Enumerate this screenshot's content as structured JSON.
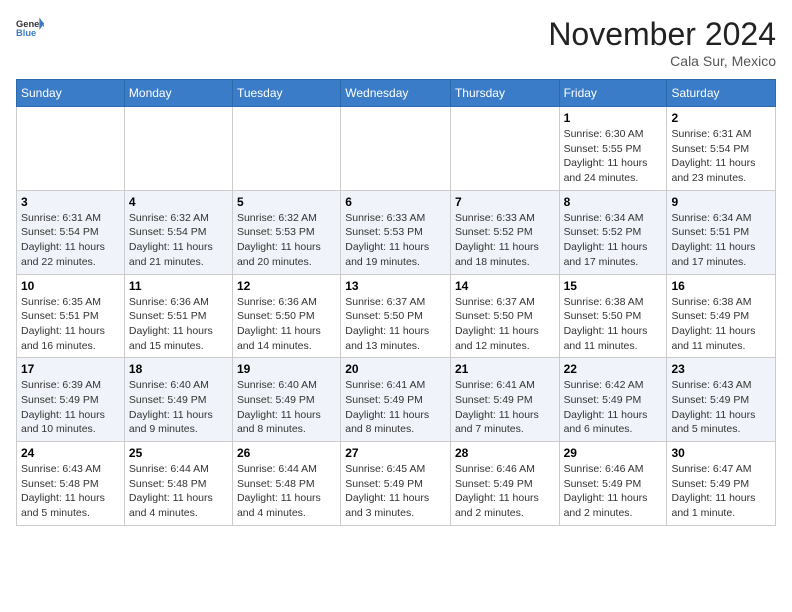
{
  "header": {
    "logo_general": "General",
    "logo_blue": "Blue",
    "month_title": "November 2024",
    "location": "Cala Sur, Mexico"
  },
  "weekdays": [
    "Sunday",
    "Monday",
    "Tuesday",
    "Wednesday",
    "Thursday",
    "Friday",
    "Saturday"
  ],
  "weeks": [
    [
      {
        "day": "",
        "info": ""
      },
      {
        "day": "",
        "info": ""
      },
      {
        "day": "",
        "info": ""
      },
      {
        "day": "",
        "info": ""
      },
      {
        "day": "",
        "info": ""
      },
      {
        "day": "1",
        "info": "Sunrise: 6:30 AM\nSunset: 5:55 PM\nDaylight: 11 hours and 24 minutes."
      },
      {
        "day": "2",
        "info": "Sunrise: 6:31 AM\nSunset: 5:54 PM\nDaylight: 11 hours and 23 minutes."
      }
    ],
    [
      {
        "day": "3",
        "info": "Sunrise: 6:31 AM\nSunset: 5:54 PM\nDaylight: 11 hours and 22 minutes."
      },
      {
        "day": "4",
        "info": "Sunrise: 6:32 AM\nSunset: 5:54 PM\nDaylight: 11 hours and 21 minutes."
      },
      {
        "day": "5",
        "info": "Sunrise: 6:32 AM\nSunset: 5:53 PM\nDaylight: 11 hours and 20 minutes."
      },
      {
        "day": "6",
        "info": "Sunrise: 6:33 AM\nSunset: 5:53 PM\nDaylight: 11 hours and 19 minutes."
      },
      {
        "day": "7",
        "info": "Sunrise: 6:33 AM\nSunset: 5:52 PM\nDaylight: 11 hours and 18 minutes."
      },
      {
        "day": "8",
        "info": "Sunrise: 6:34 AM\nSunset: 5:52 PM\nDaylight: 11 hours and 17 minutes."
      },
      {
        "day": "9",
        "info": "Sunrise: 6:34 AM\nSunset: 5:51 PM\nDaylight: 11 hours and 17 minutes."
      }
    ],
    [
      {
        "day": "10",
        "info": "Sunrise: 6:35 AM\nSunset: 5:51 PM\nDaylight: 11 hours and 16 minutes."
      },
      {
        "day": "11",
        "info": "Sunrise: 6:36 AM\nSunset: 5:51 PM\nDaylight: 11 hours and 15 minutes."
      },
      {
        "day": "12",
        "info": "Sunrise: 6:36 AM\nSunset: 5:50 PM\nDaylight: 11 hours and 14 minutes."
      },
      {
        "day": "13",
        "info": "Sunrise: 6:37 AM\nSunset: 5:50 PM\nDaylight: 11 hours and 13 minutes."
      },
      {
        "day": "14",
        "info": "Sunrise: 6:37 AM\nSunset: 5:50 PM\nDaylight: 11 hours and 12 minutes."
      },
      {
        "day": "15",
        "info": "Sunrise: 6:38 AM\nSunset: 5:50 PM\nDaylight: 11 hours and 11 minutes."
      },
      {
        "day": "16",
        "info": "Sunrise: 6:38 AM\nSunset: 5:49 PM\nDaylight: 11 hours and 11 minutes."
      }
    ],
    [
      {
        "day": "17",
        "info": "Sunrise: 6:39 AM\nSunset: 5:49 PM\nDaylight: 11 hours and 10 minutes."
      },
      {
        "day": "18",
        "info": "Sunrise: 6:40 AM\nSunset: 5:49 PM\nDaylight: 11 hours and 9 minutes."
      },
      {
        "day": "19",
        "info": "Sunrise: 6:40 AM\nSunset: 5:49 PM\nDaylight: 11 hours and 8 minutes."
      },
      {
        "day": "20",
        "info": "Sunrise: 6:41 AM\nSunset: 5:49 PM\nDaylight: 11 hours and 8 minutes."
      },
      {
        "day": "21",
        "info": "Sunrise: 6:41 AM\nSunset: 5:49 PM\nDaylight: 11 hours and 7 minutes."
      },
      {
        "day": "22",
        "info": "Sunrise: 6:42 AM\nSunset: 5:49 PM\nDaylight: 11 hours and 6 minutes."
      },
      {
        "day": "23",
        "info": "Sunrise: 6:43 AM\nSunset: 5:49 PM\nDaylight: 11 hours and 5 minutes."
      }
    ],
    [
      {
        "day": "24",
        "info": "Sunrise: 6:43 AM\nSunset: 5:48 PM\nDaylight: 11 hours and 5 minutes."
      },
      {
        "day": "25",
        "info": "Sunrise: 6:44 AM\nSunset: 5:48 PM\nDaylight: 11 hours and 4 minutes."
      },
      {
        "day": "26",
        "info": "Sunrise: 6:44 AM\nSunset: 5:48 PM\nDaylight: 11 hours and 4 minutes."
      },
      {
        "day": "27",
        "info": "Sunrise: 6:45 AM\nSunset: 5:49 PM\nDaylight: 11 hours and 3 minutes."
      },
      {
        "day": "28",
        "info": "Sunrise: 6:46 AM\nSunset: 5:49 PM\nDaylight: 11 hours and 2 minutes."
      },
      {
        "day": "29",
        "info": "Sunrise: 6:46 AM\nSunset: 5:49 PM\nDaylight: 11 hours and 2 minutes."
      },
      {
        "day": "30",
        "info": "Sunrise: 6:47 AM\nSunset: 5:49 PM\nDaylight: 11 hours and 1 minute."
      }
    ]
  ]
}
